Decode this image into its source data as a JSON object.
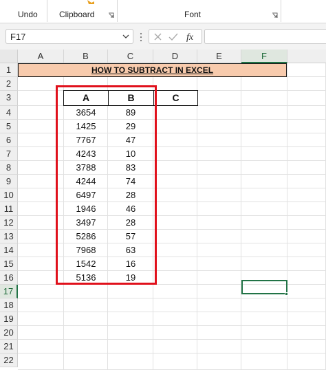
{
  "ribbon": {
    "groups": [
      {
        "label": "Undo"
      },
      {
        "label": "Clipboard"
      },
      {
        "label": "Font"
      }
    ]
  },
  "formula_bar": {
    "name_box": "F17",
    "formula": ""
  },
  "sheet": {
    "columns": [
      "A",
      "B",
      "C",
      "D",
      "E",
      "F"
    ],
    "rows": [
      "1",
      "2",
      "3",
      "4",
      "5",
      "6",
      "7",
      "8",
      "9",
      "10",
      "11",
      "12",
      "13",
      "14",
      "15",
      "16",
      "17",
      "18",
      "19",
      "20",
      "21",
      "22"
    ],
    "title": "HOW TO SUBTRACT IN EXCEL",
    "table_headers": [
      "A",
      "B",
      "C"
    ],
    "table_rows": [
      [
        "3654",
        "89"
      ],
      [
        "1425",
        "29"
      ],
      [
        "7767",
        "47"
      ],
      [
        "4243",
        "10"
      ],
      [
        "3788",
        "83"
      ],
      [
        "4244",
        "74"
      ],
      [
        "6497",
        "28"
      ],
      [
        "1946",
        "46"
      ],
      [
        "3497",
        "28"
      ],
      [
        "5286",
        "57"
      ],
      [
        "7968",
        "63"
      ],
      [
        "1542",
        "16"
      ],
      [
        "5136",
        "19"
      ]
    ],
    "selected_cell": "F17",
    "accent_color": "#217346",
    "title_fill": "#f8cbad",
    "highlight_color": "#e0101b"
  }
}
